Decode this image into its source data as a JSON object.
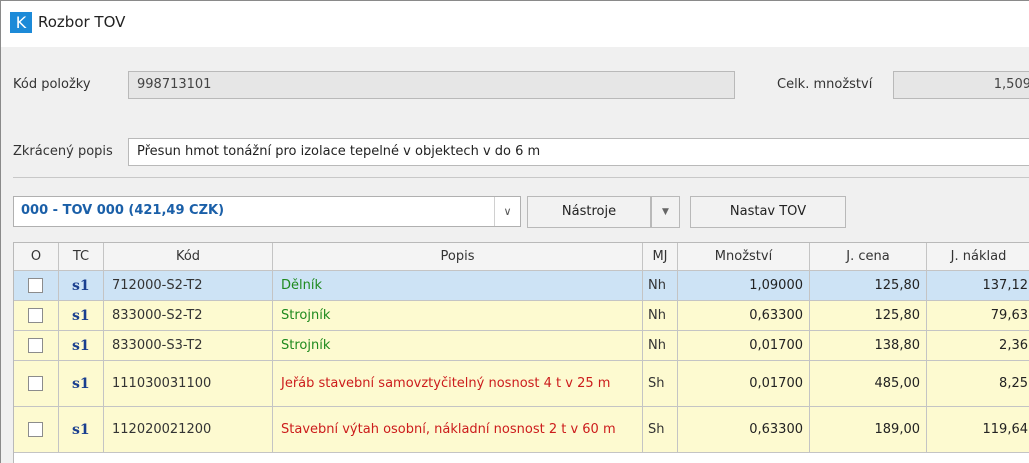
{
  "window": {
    "title": "Rozbor TOV",
    "icon_letter": "K"
  },
  "form": {
    "kod_polozky_label": "Kód položky",
    "kod_polozky_value": "998713101",
    "celk_mnozstvi_label": "Celk. množství",
    "celk_mnozstvi_value": "1,509",
    "zkraceny_popis_label": "Zkrácený popis",
    "zkraceny_popis_value": "Přesun hmot tonážní pro izolace tepelné v objektech v do 6 m"
  },
  "toolbar": {
    "tov_selected": "000 - TOV 000 (421,49 CZK)",
    "nastroje_label": "Nástroje",
    "nastav_tov_label": "Nastav TOV"
  },
  "table": {
    "columns": [
      "O",
      "TC",
      "Kód",
      "Popis",
      "MJ",
      "Množství",
      "J. cena",
      "J. náklad"
    ],
    "rows": [
      {
        "checked": false,
        "tc": "s1",
        "kod": "712000-S2-T2",
        "popis": "Dělník",
        "popis_color": "green",
        "mj": "Nh",
        "mnozstvi": "1,09000",
        "j_cena": "125,80",
        "j_naklad": "137,12",
        "selected": true
      },
      {
        "checked": false,
        "tc": "s1",
        "kod": "833000-S2-T2",
        "popis": "Strojník",
        "popis_color": "green",
        "mj": "Nh",
        "mnozstvi": "0,63300",
        "j_cena": "125,80",
        "j_naklad": "79,63",
        "selected": false
      },
      {
        "checked": false,
        "tc": "s1",
        "kod": "833000-S3-T2",
        "popis": "Strojník",
        "popis_color": "green",
        "mj": "Nh",
        "mnozstvi": "0,01700",
        "j_cena": "138,80",
        "j_naklad": "2,36",
        "selected": false
      },
      {
        "checked": false,
        "tc": "s1",
        "kod": "111030031100",
        "popis": "Jeřáb stavební samovztyčitelný nosnost 4 t v 25 m",
        "popis_color": "red",
        "mj": "Sh",
        "mnozstvi": "0,01700",
        "j_cena": "485,00",
        "j_naklad": "8,25",
        "selected": false
      },
      {
        "checked": false,
        "tc": "s1",
        "kod": "112020021200",
        "popis": "Stavební výtah osobní, nákladní nosnost 2 t v 60 m",
        "popis_color": "red",
        "mj": "Sh",
        "mnozstvi": "0,63300",
        "j_cena": "189,00",
        "j_naklad": "119,64",
        "selected": false
      }
    ]
  },
  "colors": {
    "selected_row": "#cde3f5",
    "normal_row": "#fdfad0",
    "labor_text": "#1e8a1e",
    "machine_text": "#cc1c1c",
    "tc_text": "#1a3f8f",
    "combo_text": "#1a5fa8",
    "app_icon": "#1c8ad8"
  },
  "icons": {
    "app": "k-logo-icon",
    "combo_dropdown": "chevron-down-icon",
    "nastroje_dropdown": "triangle-down-icon",
    "row_checkbox": "checkbox-icon"
  }
}
